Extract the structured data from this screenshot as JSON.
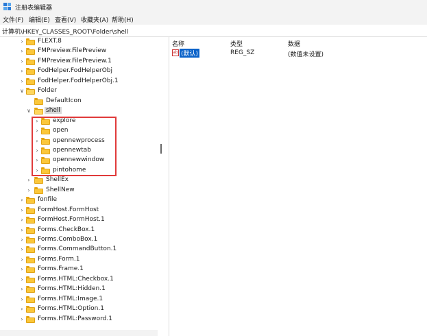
{
  "window": {
    "title": "注册表编辑器"
  },
  "menu": [
    {
      "label": "文件(F)"
    },
    {
      "label": "编辑(E)"
    },
    {
      "label": "查看(V)"
    },
    {
      "label": "收藏夹(A)"
    },
    {
      "label": "帮助(H)"
    }
  ],
  "address": "计算机\\HKEY_CLASSES_ROOT\\Folder\\shell",
  "tree": [
    {
      "label": "FLEXT.8",
      "depth": 0,
      "expander": "collapsed"
    },
    {
      "label": "FMPreview.FilePreview",
      "depth": 0,
      "expander": "collapsed"
    },
    {
      "label": "FMPreview.FilePreview.1",
      "depth": 0,
      "expander": "collapsed"
    },
    {
      "label": "FodHelper.FodHelperObj",
      "depth": 0,
      "expander": "collapsed"
    },
    {
      "label": "FodHelper.FodHelperObj.1",
      "depth": 0,
      "expander": "collapsed"
    },
    {
      "label": "Folder",
      "depth": 0,
      "expander": "expanded"
    },
    {
      "label": "DefaultIcon",
      "depth": 1,
      "expander": "none"
    },
    {
      "label": "shell",
      "depth": 1,
      "expander": "expanded",
      "selected": true
    },
    {
      "label": "explore",
      "depth": 2,
      "expander": "collapsed"
    },
    {
      "label": "open",
      "depth": 2,
      "expander": "collapsed"
    },
    {
      "label": "opennewprocess",
      "depth": 2,
      "expander": "collapsed"
    },
    {
      "label": "opennewtab",
      "depth": 2,
      "expander": "collapsed"
    },
    {
      "label": "opennewwindow",
      "depth": 2,
      "expander": "collapsed"
    },
    {
      "label": "pintohome",
      "depth": 2,
      "expander": "collapsed"
    },
    {
      "label": "ShellEx",
      "depth": 1,
      "expander": "collapsed"
    },
    {
      "label": "ShellNew",
      "depth": 1,
      "expander": "collapsed"
    },
    {
      "label": "fonfile",
      "depth": 0,
      "expander": "collapsed"
    },
    {
      "label": "FormHost.FormHost",
      "depth": 0,
      "expander": "collapsed"
    },
    {
      "label": "FormHost.FormHost.1",
      "depth": 0,
      "expander": "collapsed"
    },
    {
      "label": "Forms.CheckBox.1",
      "depth": 0,
      "expander": "collapsed"
    },
    {
      "label": "Forms.ComboBox.1",
      "depth": 0,
      "expander": "collapsed"
    },
    {
      "label": "Forms.CommandButton.1",
      "depth": 0,
      "expander": "collapsed"
    },
    {
      "label": "Forms.Form.1",
      "depth": 0,
      "expander": "collapsed"
    },
    {
      "label": "Forms.Frame.1",
      "depth": 0,
      "expander": "collapsed"
    },
    {
      "label": "Forms.HTML:Checkbox.1",
      "depth": 0,
      "expander": "collapsed"
    },
    {
      "label": "Forms.HTML:Hidden.1",
      "depth": 0,
      "expander": "collapsed"
    },
    {
      "label": "Forms.HTML:Image.1",
      "depth": 0,
      "expander": "collapsed"
    },
    {
      "label": "Forms.HTML:Option.1",
      "depth": 0,
      "expander": "collapsed"
    },
    {
      "label": "Forms.HTML:Password.1",
      "depth": 0,
      "expander": "collapsed"
    }
  ],
  "values_pane": {
    "columns": {
      "name": "名称",
      "type": "类型",
      "data": "数据"
    },
    "rows": [
      {
        "name": "(默认)",
        "type": "REG_SZ",
        "data": "(数值未设置)",
        "icon": "string-value-icon"
      }
    ]
  },
  "colors": {
    "highlight_box": "#e03a3a",
    "selected_value": "#0a62c9",
    "folder": "#fbc73a"
  }
}
